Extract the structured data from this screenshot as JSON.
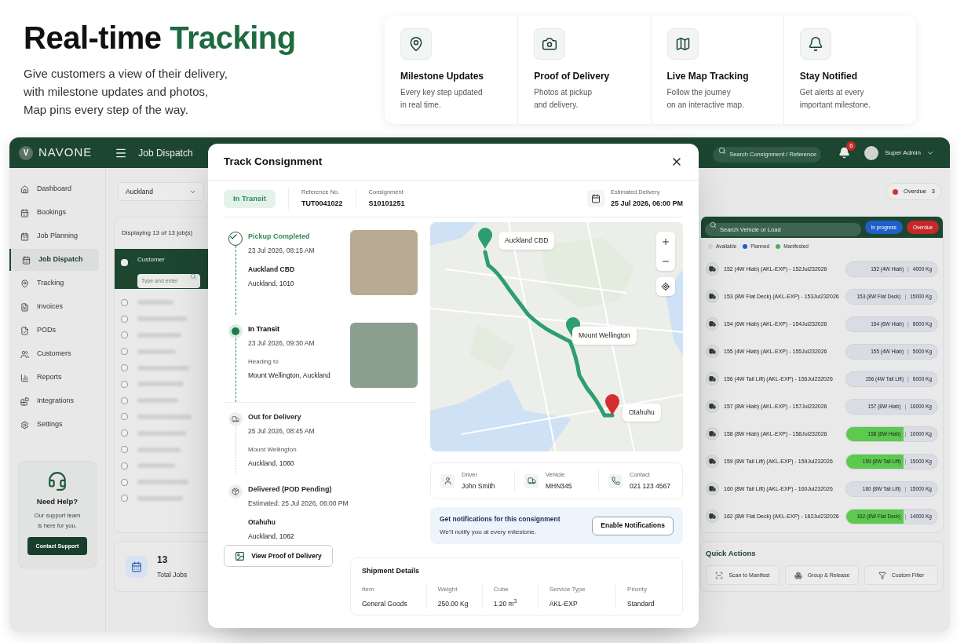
{
  "hero": {
    "title": [
      {
        "text": "Real-time",
        "accent": false
      },
      {
        "text": "Tracking",
        "accent": true
      }
    ],
    "subtitle_lines": [
      "Give customers a view of their delivery,",
      "with milestone updates and photos,",
      "Map pins every step of the way."
    ]
  },
  "features": [
    {
      "title": "Milestone Updates",
      "description_lines": [
        "Every key step updated",
        "in real time."
      ]
    },
    {
      "title": "Proof of Delivery",
      "description_lines": [
        "Photos at pickup",
        "and delivery."
      ]
    },
    {
      "title": "Live Map Tracking",
      "description_lines": [
        "Follow the journey",
        "on an interactive map."
      ]
    },
    {
      "title": "Stay Notified",
      "description_lines": [
        "Get alerts at every",
        "important milestone."
      ]
    }
  ],
  "top_bar": {
    "logo_letter": "V",
    "brand": "NAVONE",
    "page_title": "Job Dispatch",
    "search_placeholder": "Search Consignment / Reference",
    "notification_count": "6",
    "user": "Super Admin"
  },
  "nav": [
    {
      "label": "Dashboard",
      "selected": false
    },
    {
      "label": "Bookings",
      "selected": false
    },
    {
      "label": "Job Planning",
      "selected": false
    },
    {
      "label": "Job Dispatch",
      "selected": true
    },
    {
      "label": "Tracking",
      "selected": false
    },
    {
      "label": "Invoices",
      "selected": false
    },
    {
      "label": "PODs",
      "selected": false
    },
    {
      "label": "Customers",
      "selected": false
    },
    {
      "label": "Reports",
      "selected": false
    },
    {
      "label": "Integrations",
      "selected": false
    },
    {
      "label": "Settings",
      "selected": false
    }
  ],
  "help": {
    "title": "Need Help?",
    "text_lines": [
      "Our support team",
      "is here for you."
    ],
    "button": "Contact Support"
  },
  "jobs": {
    "region": "Auckland",
    "count_text": "Displaying 13 of 13 job(s)",
    "column": "Customer",
    "filter_placeholder": "Type and enter",
    "all_checked": false,
    "rows": [
      {
        "checked": false
      },
      {
        "checked": false
      },
      {
        "checked": false
      },
      {
        "checked": false
      },
      {
        "checked": false
      },
      {
        "checked": false
      },
      {
        "checked": false
      },
      {
        "checked": false
      },
      {
        "checked": false
      },
      {
        "checked": false
      },
      {
        "checked": false
      },
      {
        "checked": false
      },
      {
        "checked": false
      }
    ],
    "total_value": "13",
    "total_label": "Total Jobs"
  },
  "overdue_chip": {
    "label": "Overdue",
    "count": "3",
    "color": "#d32f2f"
  },
  "vehicles_panel": {
    "search_placeholder": "Search Vehicle or Load",
    "filters": [
      {
        "label": "In progress",
        "color": "#1e5fc8"
      },
      {
        "label": "Overdue",
        "color": "#c62828"
      }
    ],
    "legend": [
      {
        "label": "Available",
        "color": "#d4d6dc"
      },
      {
        "label": "Planned",
        "color": "#1e5fc8"
      },
      {
        "label": "Manifested",
        "color": "#4caf50"
      }
    ],
    "vehicles": [
      {
        "name": "152 (4W Hiab) (AKL-EXP) - 152Jul232026",
        "vehicle": "152 (4W Hiab)",
        "separator": "|",
        "weight": "4000 Kg",
        "level": 0
      },
      {
        "name": "153 (8W Flat Deck) (AKL-EXP) - 153Jul232026",
        "vehicle": "153 (8W Flat Deck)",
        "separator": "|",
        "weight": "15000 Kg",
        "level": 0
      },
      {
        "name": "154 (6W Hiab) (AKL-EXP) - 154Jul232026",
        "vehicle": "154 (6W Hiab)",
        "separator": "|",
        "weight": "8000 Kg",
        "level": 0
      },
      {
        "name": "155 (4W Hiab) (AKL-EXP) - 155Jul232026",
        "vehicle": "155 (4W Hiab)",
        "separator": "|",
        "weight": "5000 Kg",
        "level": 0
      },
      {
        "name": "156 (4W Tail Lift) (AKL-EXP) - 156Jul232026",
        "vehicle": "156 (4W Tail Lift)",
        "separator": "|",
        "weight": "6000 Kg",
        "level": 0
      },
      {
        "name": "157 (8W Hiab) (AKL-EXP) - 157Jul232026",
        "vehicle": "157 (8W Hiab)",
        "separator": "|",
        "weight": "10000 Kg",
        "level": 0
      },
      {
        "name": "158 (8W Hiab) (AKL-EXP) - 158Jul232026",
        "vehicle": "158 (8W Hiab)",
        "separator": "|",
        "weight": "10000 Kg",
        "level": 0.63
      },
      {
        "name": "159 (8W Tail Lift) (AKL-EXP) - 159Jul232026",
        "vehicle": "159 (8W Tail Lift)",
        "separator": "|",
        "weight": "15000 Kg",
        "level": 0.63
      },
      {
        "name": "160 (8W Tail Lift) (AKL-EXP) - 160Jul232026",
        "vehicle": "160 (8W Tail Lift)",
        "separator": "|",
        "weight": "15000 Kg",
        "level": 0
      },
      {
        "name": "162 (8W Flat Deck) (AKL-EXP) - 162Jul232026",
        "vehicle": "162 (8W Flat Deck)",
        "separator": "|",
        "weight": "14000 Kg",
        "level": 0.63
      }
    ]
  },
  "quick_actions": {
    "title": "Quick Actions",
    "buttons": [
      "Scan to Manifest",
      "Group & Release",
      "Custom Filter"
    ]
  },
  "modal": {
    "title": "Track Consignment",
    "status": "In Transit",
    "fields": [
      {
        "label": "Reference No.",
        "value": "TUT0041022"
      },
      {
        "label": "Consignment",
        "value": "S10101251"
      }
    ],
    "estimated": {
      "label": "Estimated Delivery",
      "value": "25 Jul 2026, 06:00 PM"
    },
    "timeline": [
      {
        "completed": true,
        "current": false,
        "title": "Pickup Completed",
        "time": "23 Jul 2026, 08:15 AM",
        "place": "Auckland CBD",
        "detail": "Auckland, 1010",
        "photo": true
      },
      {
        "completed": false,
        "current": true,
        "title": "In Transit",
        "time": "23 Jul 2026, 09:30 AM",
        "note": "Heading to",
        "detail": "Mount Wellington, Auckland",
        "photo": true
      },
      {
        "completed": false,
        "current": false,
        "title": "Out for Delivery",
        "time": "25 Jul 2026, 08:45 AM",
        "note": "Mount Wellington",
        "detail": "Auckland, 1060",
        "photo": false
      },
      {
        "completed": false,
        "current": false,
        "title": "Delivered (POD Pending)",
        "time": "Estimated: 25 Jul 2026, 06:00 PM",
        "place": "Otahuhu",
        "detail": "Auckland, 1062",
        "photo": false
      }
    ],
    "pod_button": "View Proof of Delivery",
    "map_pins": [
      {
        "label": "Auckland CBD",
        "color": "#2e9e6e"
      },
      {
        "label": "Mount Wellington",
        "color": "#2e9e6e"
      },
      {
        "label": "Otahuhu",
        "color": "#d32f2f"
      }
    ],
    "contacts": [
      {
        "label": "Driver",
        "value": "John Smith"
      },
      {
        "label": "Vehicle",
        "value": "MHN345"
      },
      {
        "label": "Contact",
        "value": "021 123 4567"
      }
    ],
    "notify": {
      "title": "Get notifications for this consignment",
      "text": "We’ll notify you at every milestone.",
      "button": "Enable Notifications"
    },
    "shipment": {
      "title": "Shipment Details",
      "fields": [
        {
          "label": "Item",
          "value": "General Goods"
        },
        {
          "label": "Weight",
          "value": "250.00 Kg"
        },
        {
          "label": "Cube",
          "value": "1.20 m$^{3}$"
        },
        {
          "label": "Service Type",
          "value": "AKL-EXP"
        },
        {
          "label": "Priority",
          "value": "Standard"
        }
      ]
    }
  }
}
